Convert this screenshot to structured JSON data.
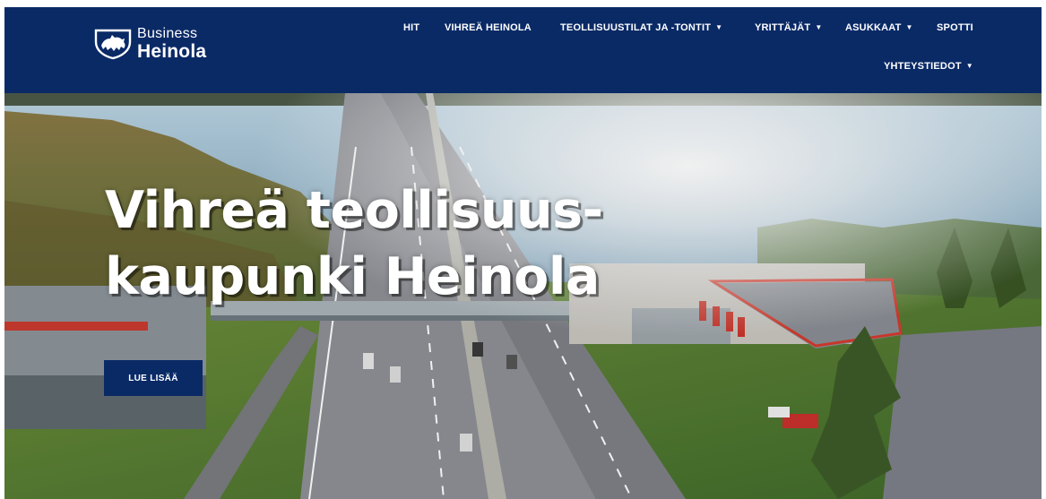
{
  "brand": {
    "line1": "Business",
    "line2": "Heinola"
  },
  "nav": {
    "items": [
      {
        "label": "HIT"
      },
      {
        "label": "VIHREÄ HEINOLA"
      },
      {
        "label": "TEOLLISUUSTILAT JA -TONTIT"
      },
      {
        "label": "YRITTÄJÄT"
      },
      {
        "label": "ASUKKAAT"
      },
      {
        "label": "SPOTTI"
      },
      {
        "label": "YHTEYSTIEDOT"
      }
    ],
    "dropdown_glyph": "▼"
  },
  "hero": {
    "title_line1": "Vihreä teollisuus-",
    "title_line2": "kaupunki Heinola",
    "button_label": "LUE LISÄÄ"
  },
  "colors": {
    "header_bg": "#0a2a66",
    "button_bg": "#0a2a66",
    "text": "#ffffff"
  },
  "icons": [
    "heinola-crest-icon",
    "chevron-down-icon"
  ]
}
